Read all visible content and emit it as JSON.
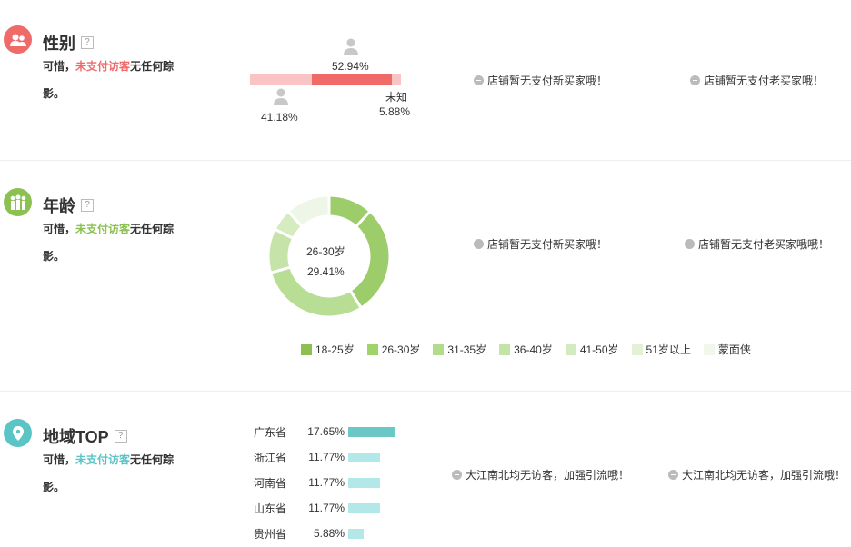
{
  "gender": {
    "title": "性别",
    "help": "?",
    "desc_prefix": "可惜，",
    "desc_highlight": "未支付访客",
    "desc_suffix": "无任何踪影。",
    "male_pct": "52.94%",
    "female_pct": "41.18%",
    "unknown_label": "未知",
    "unknown_pct": "5.88%",
    "male_value": 52.94,
    "female_value": 41.18,
    "unknown_value": 5.88,
    "notice_new": "店铺暂无支付新买家哦！",
    "notice_old": "店铺暂无支付老买家哦！",
    "accent": "#f06a6a"
  },
  "age": {
    "title": "年龄",
    "help": "?",
    "desc_prefix": "可惜，",
    "desc_highlight": "未支付访客",
    "desc_suffix": "无任何踪影。",
    "center_label": "26-30岁",
    "center_value": "29.41%",
    "notice_new": "店铺暂无支付新买家哦！",
    "notice_old": "店铺暂无支付老买家哦哦！",
    "accent": "#8cc152",
    "legend": [
      {
        "label": "18-25岁",
        "color": "#8cc152"
      },
      {
        "label": "26-30岁",
        "color": "#9ed46a"
      },
      {
        "label": "31-35岁",
        "color": "#b1dc8a"
      },
      {
        "label": "36-40岁",
        "color": "#c3e4a6"
      },
      {
        "label": "41-50岁",
        "color": "#d3ebbf"
      },
      {
        "label": "51岁以上",
        "color": "#e3f1d7"
      },
      {
        "label": "蒙面侠",
        "color": "#f1f7ea"
      }
    ]
  },
  "chart_data": {
    "type": "pie",
    "categories": [
      "18-25岁",
      "26-30岁",
      "31-35岁",
      "36-40岁",
      "41-50岁",
      "51岁以上",
      "蒙面侠"
    ],
    "values": [
      11.76,
      29.41,
      29.41,
      11.76,
      5.88,
      0,
      11.76
    ],
    "colors": [
      "#9ccd6a",
      "#9ccd6a",
      "#b8dd94",
      "#c6e4a9",
      "#d5ebc0",
      "#e5f2d9",
      "#eef6e7"
    ],
    "title": ""
  },
  "region": {
    "title": "地域TOP",
    "help": "?",
    "desc_prefix": "可惜，",
    "desc_highlight": "未支付访客",
    "desc_suffix": "无任何踪影。",
    "accent": "#5bc4c4",
    "rows": [
      {
        "name": "广东省",
        "pct": "17.65%",
        "value": 17.65,
        "color": "#6cc7c7"
      },
      {
        "name": "浙江省",
        "pct": "11.77%",
        "value": 11.77,
        "color": "#b3e8e8"
      },
      {
        "name": "河南省",
        "pct": "11.77%",
        "value": 11.77,
        "color": "#b3e8e8"
      },
      {
        "name": "山东省",
        "pct": "11.77%",
        "value": 11.77,
        "color": "#b3e8e8"
      },
      {
        "name": "贵州省",
        "pct": "5.88%",
        "value": 5.88,
        "color": "#b3e8e8"
      }
    ],
    "notice_1": "大江南北均无访客，加强引流哦！",
    "notice_2": "大江南北均无访客，加强引流哦！"
  }
}
